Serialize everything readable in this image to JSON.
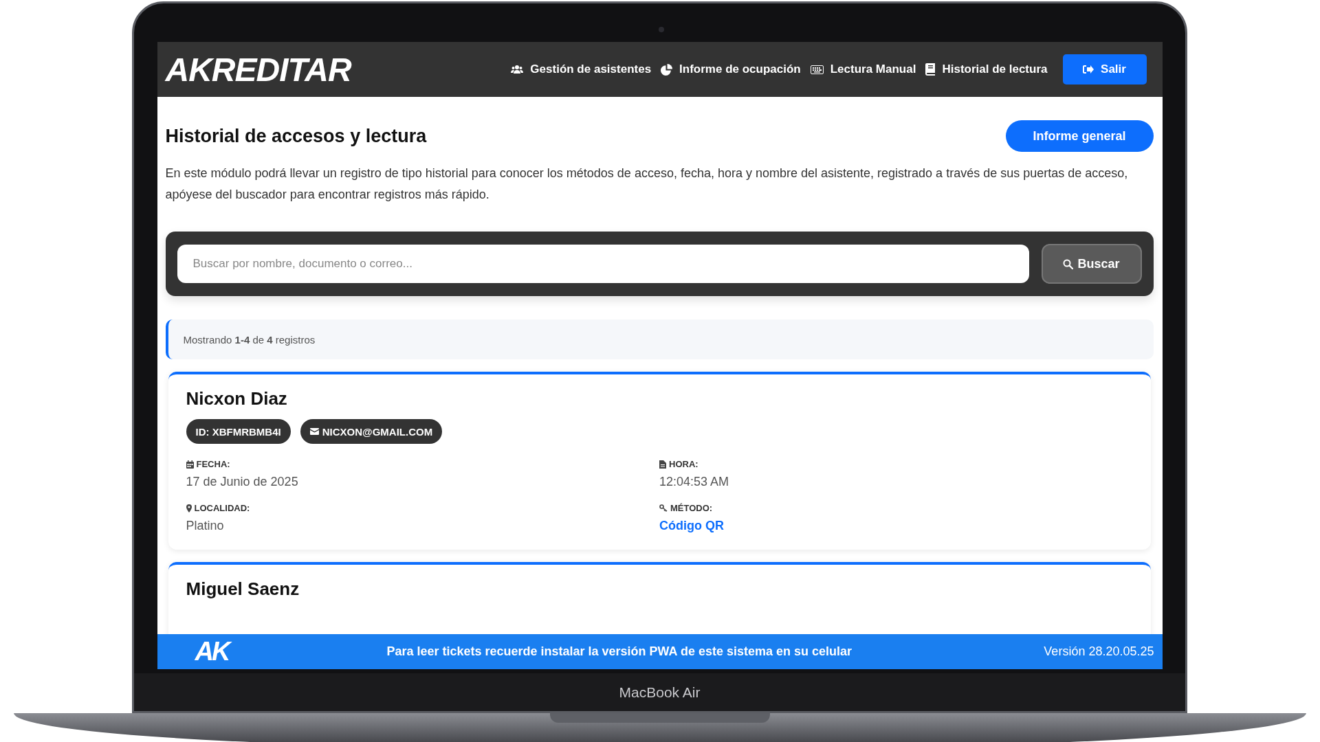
{
  "device": {
    "label": "MacBook Air"
  },
  "navbar": {
    "logo": "A**K**REDITAR",
    "items": [
      {
        "label": "Gestión de asistentes"
      },
      {
        "label": "Informe de ocupación"
      },
      {
        "label": "Lectura Manual"
      },
      {
        "label": "Historial de lectura"
      }
    ],
    "logout_button": "Salir"
  },
  "page": {
    "title": "Historial de accesos y lectura",
    "report_button": "Informe general",
    "description": "En este módulo podrá llevar un registro de tipo historial para conocer los métodos de acceso, fecha, hora y nombre del asistente, registrado a través de sus puertas de acceso, apóyese del buscador para encontrar registros más rápido."
  },
  "search": {
    "placeholder": "Buscar por nombre, documento o correo...",
    "button": "Buscar"
  },
  "results_info": "Mostrando **1-4** de **4** registros",
  "records": [
    {
      "name": "Nicxon Diaz",
      "id_badge": "ID: XBFMRBMB4I",
      "email_badge": "NICXON@GMAIL.COM",
      "fields": [
        {
          "label": "FECHA:",
          "value": "17 de Junio de 2025",
          "kind": "text"
        },
        {
          "label": "HORA:",
          "value": "12:04:53 AM",
          "kind": "text"
        },
        {
          "label": "LOCALIDAD:",
          "value": "Platino",
          "kind": "text"
        },
        {
          "label": "MÉTODO:",
          "value": "Código QR",
          "kind": "method"
        }
      ]
    },
    {
      "name": "Miguel Saenz"
    }
  ],
  "footer": {
    "logo": "AK",
    "message": "Para leer tickets recuerde instalar la versión PWA de este sistema en su celular",
    "version": "Versión 28.20.05.25"
  }
}
